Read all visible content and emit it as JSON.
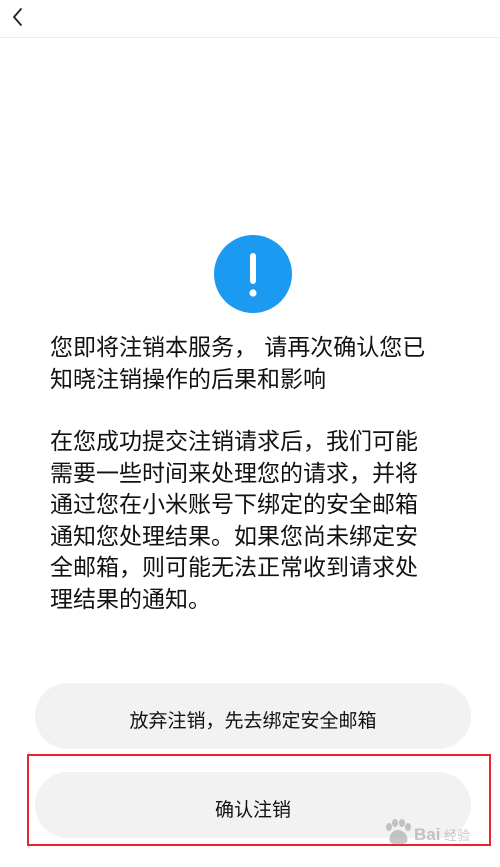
{
  "header": {
    "back_icon": "chevron-left-icon"
  },
  "notice": {
    "icon": "exclamation-circle-icon",
    "icon_color": "#1a9af0",
    "main_lines": [
      "您即将注销本服务， 请再次确认您已",
      "知晓注销操作的后果和影响"
    ],
    "detail_lines": [
      "在您成功提交注销请求后，我们可能",
      "需要一些时间来处理您的请求，并将",
      "通过您在小米账号下绑定的安全邮箱",
      "通知您处理结果。如果您尚未绑定安",
      "全邮箱，则可能无法正常收到请求处",
      "理结果的通知。"
    ]
  },
  "actions": {
    "abandon_label": "放弃注销，先去绑定安全邮箱",
    "confirm_label": "确认注销"
  },
  "colors": {
    "button_bg": "#f2f2f2",
    "highlight_border": "#e8232d"
  },
  "watermark": {
    "text": "Baidu经验"
  }
}
